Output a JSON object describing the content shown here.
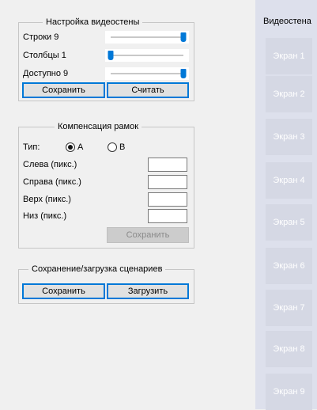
{
  "video_wall": {
    "title": "Видеостена",
    "screens": [
      "Экран 1",
      "Экран 2",
      "Экран 3",
      "Экран 4",
      "Экран 5",
      "Экран 6",
      "Экран 7",
      "Экран 8",
      "Экран 9"
    ]
  },
  "settings": {
    "title": "Настройка видеостены",
    "rows_label": "Строки 9",
    "rows_value": 9,
    "cols_label": "Столбцы 1",
    "cols_value": 1,
    "available_label": "Доступно 9",
    "available_value": 9,
    "slider_max": 9,
    "save_label": "Сохранить",
    "read_label": "Считать"
  },
  "bezel": {
    "title": "Компенсация рамок",
    "type_label": "Тип:",
    "option_a": "A",
    "option_b": "B",
    "selected": "A",
    "left_label": "Слева (пикс.)",
    "right_label": "Справа (пикс.)",
    "top_label": "Верх (пикс.)",
    "bottom_label": "Низ (пикс.)",
    "left_value": "",
    "right_value": "",
    "top_value": "",
    "bottom_value": "",
    "save_label": "Сохранить"
  },
  "scenarios": {
    "title": "Сохранение/загрузка сценариев",
    "save_label": "Сохранить",
    "load_label": "Загрузить"
  },
  "colors": {
    "accent": "#0078d7",
    "panel_bg": "#dde0ec",
    "tile_bg": "#d5d8e4"
  }
}
